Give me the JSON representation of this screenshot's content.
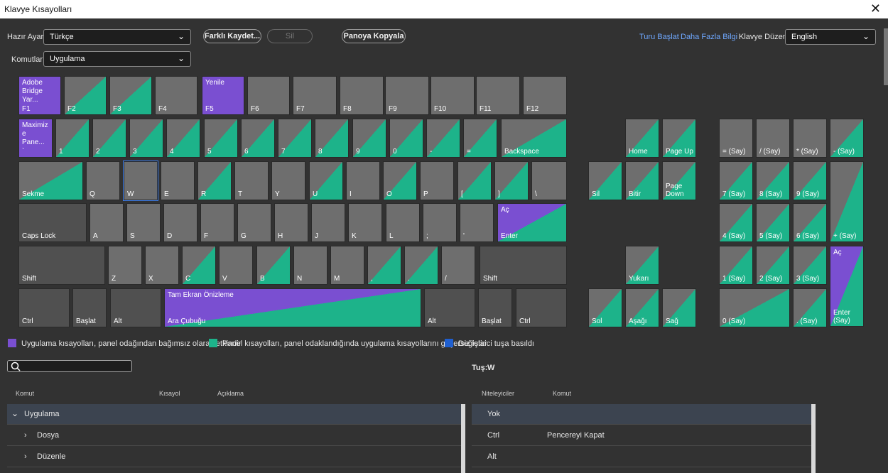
{
  "window": {
    "title": "Klavye Kısayolları",
    "close": "✕"
  },
  "toolbar": {
    "preset_label": "Hazır Ayar:",
    "preset_value": "Türkçe",
    "save_as": "Farklı Kaydet...",
    "delete": "Sil",
    "copy": "Panoya Kopyala",
    "commands_label": "Komutlar:",
    "commands_value": "Uygulama",
    "tour": "Turu Başlat",
    "more_info": "Daha Fazla Bilgi",
    "layout_label": "Klavye Düzeni:",
    "layout_value": "English"
  },
  "keys": {
    "f1": "F1",
    "f1_cmd": "Adobe Bridge Yar...",
    "f2": "F2",
    "f3": "F3",
    "f4": "F4",
    "f5": "F5",
    "f5_cmd": "Yenile",
    "f6": "F6",
    "f7": "F7",
    "f8": "F8",
    "f9": "F9",
    "f10": "F10",
    "f11": "F11",
    "f12": "F12",
    "tilde": "`",
    "tilde_cmd": "Maximiz e Pane...",
    "n1": "1",
    "n2": "2",
    "n3": "3",
    "n4": "4",
    "n5": "5",
    "n6": "6",
    "n7": "7",
    "n8": "8",
    "n9": "9",
    "n0": "0",
    "minus": "-",
    "equals": "=",
    "backspace": "Backspace",
    "tab": "Sekme",
    "q": "Q",
    "w": "W",
    "e": "E",
    "r": "R",
    "t": "T",
    "y": "Y",
    "u": "U",
    "i": "I",
    "o": "O",
    "p": "P",
    "lbr": "[",
    "rbr": "]",
    "bslash": "\\",
    "caps": "Caps Lock",
    "a": "A",
    "s": "S",
    "d": "D",
    "f": "F",
    "g": "G",
    "h": "H",
    "j": "J",
    "k": "K",
    "l": "L",
    "semi": ";",
    "quote": "'",
    "enter": "Enter",
    "enter_cmd": "Aç",
    "lshift": "Shift",
    "z": "Z",
    "x": "X",
    "c": "C",
    "v": "V",
    "b": "B",
    "n": "N",
    "m": "M",
    "comma": ",",
    "period": ".",
    "slash": "/",
    "rshift": "Shift",
    "lctrl": "Ctrl",
    "lstart": "Başlat",
    "lalt": "Alt",
    "space": "Ara Çubuğu",
    "space_cmd": "Tam Ekran Önizleme",
    "ralt": "Alt",
    "rstart": "Başlat",
    "rctrl": "Ctrl",
    "home": "Home",
    "pgup": "Page Up",
    "del": "Sil",
    "end": "Bitir",
    "pgdn": "Page Down",
    "up": "Yukarı",
    "left": "Sol",
    "down": "Aşağı",
    "right": "Sağ",
    "np_eq": "= (Say)",
    "np_div": "/ (Say)",
    "np_mul": "* (Say)",
    "np_min": "- (Say)",
    "np7": "7 (Say)",
    "np8": "8 (Say)",
    "np9": "9 (Say)",
    "np_plus": "+ (Say)",
    "np4": "4 (Say)",
    "np5": "5 (Say)",
    "np6": "6 (Say)",
    "np1": "1 (Say)",
    "np2": "2 (Say)",
    "np3": "3 (Say)",
    "np_enter": "Enter (Say)",
    "np_enter_cmd": "Aç",
    "np0": "0 (Say)",
    "np_dot": ". (Say)"
  },
  "legend": {
    "app": "Uygulama kısayolları, panel odağından bağımsız olarak etkindir",
    "panel": "Panel kısayolları, panel odaklandığında uygulama kısayollarını geçersiz kılar",
    "modifier": "Değiştirici tuşa basıldı",
    "colors": {
      "app": "#7a4fd1",
      "panel": "#1db38a",
      "modifier": "#1f5fcf"
    }
  },
  "key_info": {
    "label": "Tuş:",
    "value": "W"
  },
  "left_table": {
    "headers": {
      "command": "Komut",
      "shortcut": "Kısayol",
      "description": "Açıklama"
    },
    "rows": [
      {
        "label": "Uygulama",
        "icon": "chevron-down"
      },
      {
        "label": "Dosya",
        "icon": "chevron-right"
      },
      {
        "label": "Düzenle",
        "icon": "chevron-right"
      }
    ]
  },
  "right_table": {
    "headers": {
      "modifiers": "Niteleyiciler",
      "command": "Komut"
    },
    "rows": [
      {
        "mod": "Yok",
        "cmd": ""
      },
      {
        "mod": "Ctrl",
        "cmd": "Pencereyi Kapat"
      },
      {
        "mod": "Alt",
        "cmd": ""
      }
    ]
  }
}
